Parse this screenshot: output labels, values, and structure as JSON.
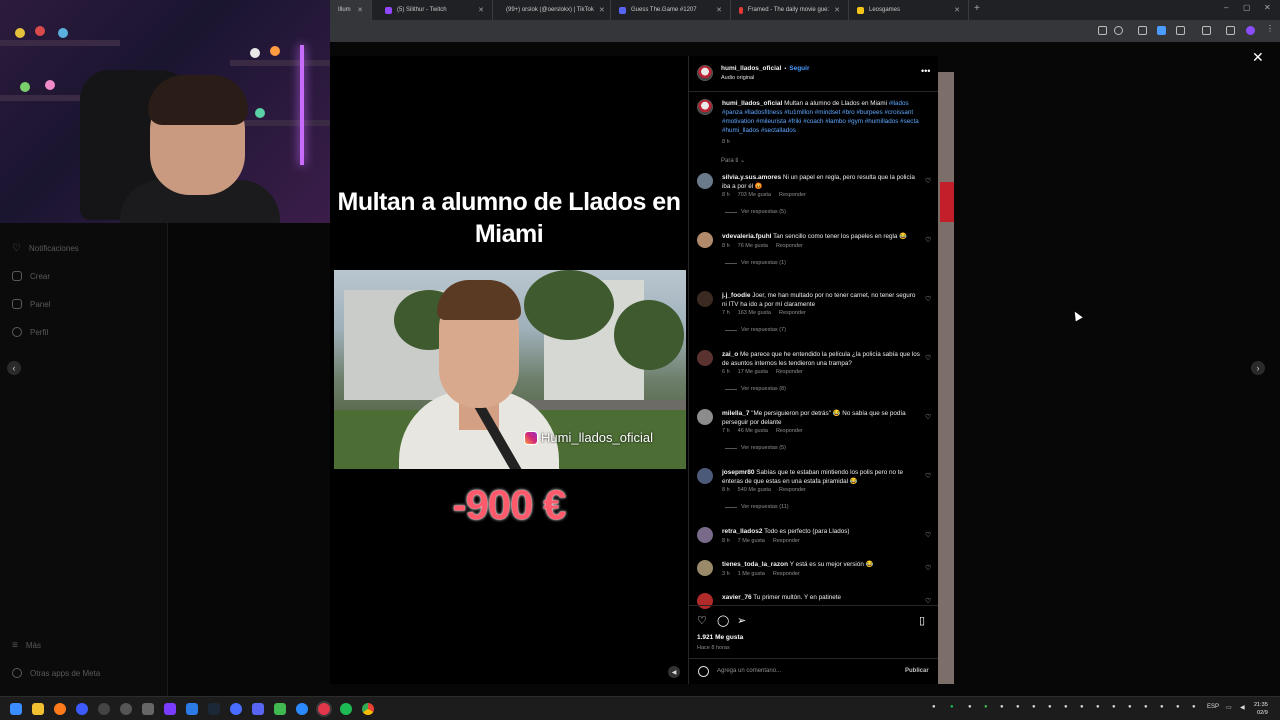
{
  "browser": {
    "tabs": [
      {
        "label": "Illum",
        "x": 0,
        "active": true
      },
      {
        "label": "(5) Silithur - Twitch"
      },
      {
        "label": "(99+) orslok (@oerslokx) | TikTok"
      },
      {
        "label": "Guess The.Game #1207"
      },
      {
        "label": "Framed - The daily movie gue:"
      },
      {
        "label": "Leosgames"
      }
    ],
    "colors": {
      "twitch": "#9146ff",
      "tiktok": "#ffffff",
      "framed": "#e53935",
      "leos": "#f5c518",
      "guess": "#5865f2"
    }
  },
  "sidebar": {
    "items": [
      {
        "label": "Notificaciones",
        "icon": "heart-icon"
      },
      {
        "label": "Crear",
        "icon": "plus-icon"
      },
      {
        "label": "Panel",
        "icon": "chart-icon"
      },
      {
        "label": "Perfil",
        "icon": "profile-icon"
      },
      {
        "label": "Más",
        "icon": "menu-icon"
      },
      {
        "label": "Otras apps de Meta",
        "icon": "meta-icon"
      }
    ]
  },
  "post": {
    "title": "Multan a alumno de Llados en Miami",
    "handle_tag": "Humi_llados_oficial",
    "fine_amount": "-900 €"
  },
  "panel": {
    "author": "humi_llados_oficial",
    "follow": "Seguir",
    "audio": "Audio original",
    "separator": "•",
    "caption_user": "humi_llados_oficial",
    "caption_text": "Multan a alumno de Llados en Miami",
    "caption_tags": "#llados #panza #lladosfitness #tu1millon #mindset #bro #burpees #croissant #motivation #mileurista #friki #coach #lambo #gym #humillados #secta #humi_llados #sectallados",
    "caption_time": "8 h",
    "sort_label": "Para ti",
    "comments": [
      {
        "user": "silvia.y.sus.amores",
        "text": "Ni un papel en regla, pero resulta que la policía iba a por él 😡",
        "time": "8 h",
        "likes": "703 Me gusta",
        "reply": "Responder",
        "replies": "Ver respuestas (5)",
        "avatar": "#6b7a8a"
      },
      {
        "user": "vdevaleria.fpuhl",
        "text": "Tan sencillo como tener los papeles en regla 😂",
        "time": "8 h",
        "likes": "76 Me gusta",
        "reply": "Responder",
        "replies": "Ver respuestas (1)",
        "avatar": "#b08a6a"
      },
      {
        "user": "j.j_foodie",
        "text": "Joer, me han multado por no tener carnet, no tener seguro ni ITV ha ido a por mí claramente",
        "time": "7 h",
        "likes": "163 Me gusta",
        "reply": "Responder",
        "replies": "Ver respuestas (7)",
        "avatar": "#3a2a22"
      },
      {
        "user": "zai_o",
        "text": "Me parece que he entendido la película ¿la policía sabía que los de asuntos internos les tendieron una trampa?",
        "time": "6 h",
        "likes": "17 Me gusta",
        "reply": "Responder",
        "replies": "Ver respuestas (8)",
        "avatar": "#5a3330"
      },
      {
        "user": "milella_7",
        "text": "\"Me persiguieron por detrás\" 😂 No sabía que se podía perseguir por delante",
        "time": "7 h",
        "likes": "46 Me gusta",
        "reply": "Responder",
        "replies": "Ver respuestas (5)",
        "avatar": "#8c8c8c"
      },
      {
        "user": "josepmr80",
        "text": "Sabías que te estaban mintiendo los polis pero no te enteras de que estas en una estafa piramidal 😂",
        "time": "8 h",
        "likes": "540 Me gusta",
        "reply": "Responder",
        "replies": "Ver respuestas (11)",
        "avatar": "#4a5a78"
      },
      {
        "user": "retra_llados2",
        "text": "Todo es perfecto (para Llados)",
        "time": "8 h",
        "likes": "7 Me gusta",
        "reply": "Responder",
        "replies": "",
        "avatar": "#7a6a8a"
      },
      {
        "user": "tienes_toda_la_razon",
        "text": "Y está es su mejor versión 😂",
        "time": "3 h",
        "likes": "1 Me gusta",
        "reply": "Responder",
        "replies": "",
        "avatar": "#9a8a6a"
      },
      {
        "user": "xavier_76",
        "text": "Tu primer multón. Y en patinete",
        "time": "",
        "likes": "",
        "reply": "",
        "replies": "",
        "avatar": "#b02a2a"
      }
    ],
    "like_count": "1.921 Me gusta",
    "posted": "Hace 8 horas",
    "comment_placeholder": "Agrega un comentario...",
    "publish": "Publicar"
  },
  "taskbar": {
    "lang": "ESP",
    "time": "21:35",
    "date": "02/9"
  }
}
